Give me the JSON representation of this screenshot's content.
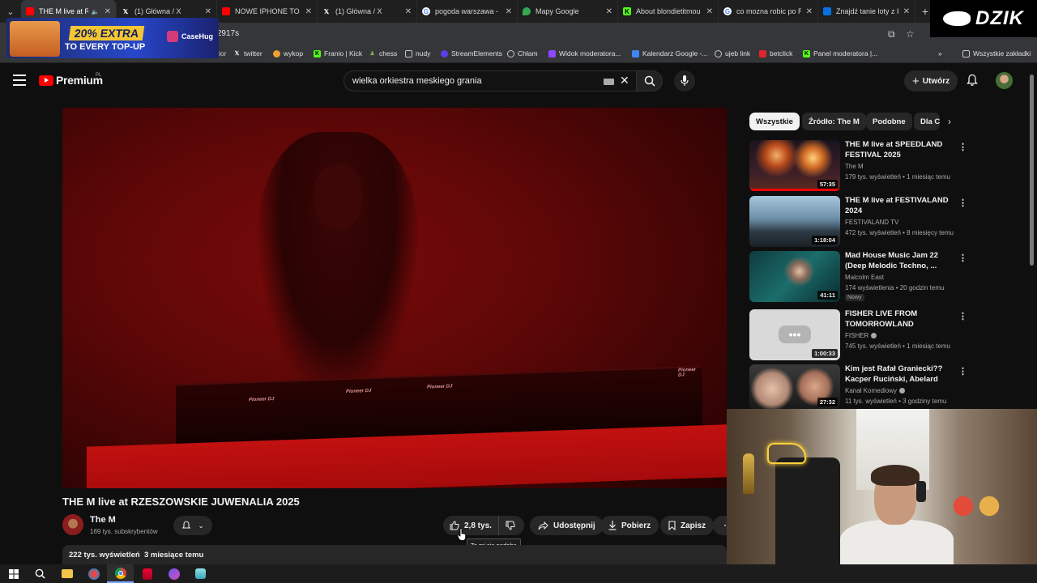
{
  "browser": {
    "tabs": [
      {
        "title": "THE M live at RZE",
        "favicon": "youtube-icon",
        "color": "#ff0000",
        "active": true,
        "muted_audio": true
      },
      {
        "title": "(1) Główna / X",
        "favicon": "x-icon",
        "color": "#ffffff"
      },
      {
        "title": "NOWE IPHONE TO P",
        "favicon": "youtube-icon",
        "color": "#ff0000"
      },
      {
        "title": "(1) Główna / X",
        "favicon": "x-icon",
        "color": "#ffffff"
      },
      {
        "title": "pogoda warszawa - S",
        "favicon": "google-icon",
        "color": "#4285f4"
      },
      {
        "title": "Mapy Google",
        "favicon": "maps-icon",
        "color": "#34a853"
      },
      {
        "title": "About blondietitmou",
        "favicon": "kick-icon",
        "color": "#53fc18"
      },
      {
        "title": "co mozna robic po R",
        "favicon": "google-icon",
        "color": "#4285f4"
      },
      {
        "title": "Znajdź tanie loty z K",
        "favicon": "flights-icon",
        "color": "#0770e3"
      }
    ],
    "url": "=2917s",
    "bookmarks": [
      {
        "label": "twitter",
        "icon": "x-icon",
        "color": "#ffffff"
      },
      {
        "label": "wykop",
        "icon": "wykop-icon",
        "color": "#f0a030"
      },
      {
        "label": "Franio | Kick",
        "icon": "kick-icon",
        "color": "#53fc18"
      },
      {
        "label": "chess",
        "icon": "chess-icon",
        "color": "#7fa650"
      },
      {
        "label": "nudy",
        "icon": "folder-icon",
        "color": "#c8c8c8"
      },
      {
        "label": "StreamElements",
        "icon": "streamelements-icon",
        "color": "#5a3fe6"
      },
      {
        "label": "Chłam",
        "icon": "globe-icon",
        "color": "#c8c8c8"
      },
      {
        "label": "Widok moderatora...",
        "icon": "twitch-icon",
        "color": "#9146ff"
      },
      {
        "label": "Kalendarz Google -...",
        "icon": "calendar-icon",
        "color": "#4285f4"
      },
      {
        "label": "ujeb link",
        "icon": "globe-icon",
        "color": "#c8c8c8"
      },
      {
        "label": "betclick",
        "icon": "betclic-icon",
        "color": "#e3262c"
      },
      {
        "label": "Panel moderatora |...",
        "icon": "kick-icon",
        "color": "#53fc18"
      }
    ],
    "bookmarks_more_icon": "chevron-right-icon",
    "all_bookmarks_label": "Wszystkie zakładki"
  },
  "overlay": {
    "ad_line1": "20% EXTRA",
    "ad_line2": "TO EVERY TOP-UP",
    "ad_brand": "CaseHug",
    "stream_logo": "DZIK"
  },
  "youtube": {
    "logo_text": "Premium",
    "country": "PL",
    "search_value": "wielka orkiestra meskiego grania",
    "create_label": "Utwórz",
    "video": {
      "title": "THE M live at RZESZOWSKIE JUWENALIA 2025",
      "channel": "The M",
      "subscribers": "169 tys. subskrybentów",
      "likes": "2,8 tys.",
      "like_tooltip": "To mi się podoba",
      "share_label": "Udostępnij",
      "download_label": "Pobierz",
      "save_label": "Zapisz",
      "views": "222 tys. wyświetleń",
      "date": "3 miesiące temu",
      "brand_marks": [
        "Pioneer DJ",
        "Pioneer DJ",
        "Pioneer DJ",
        "Pioneer DJ"
      ]
    },
    "chips": [
      "Wszystkie",
      "Źródło: The M",
      "Podobne",
      "Dla C"
    ],
    "recommendations": [
      {
        "title": "THE M live at SPEEDLAND FESTIVAL 2025",
        "channel": "The M",
        "verified": false,
        "meta": "179 tys. wyświetleń • 1 miesiąc temu",
        "duration": "57:35",
        "watched_fraction": 1.0,
        "badge": ""
      },
      {
        "title": "THE M live at FESTIVALAND 2024",
        "channel": "FESTIVALAND TV",
        "verified": false,
        "meta": "472 tys. wyświetleń • 8 miesięcy temu",
        "duration": "1:18:04",
        "watched_fraction": 0.0,
        "badge": ""
      },
      {
        "title": "Mad House Music Jam 22 (Deep Melodic Techno, ...",
        "channel": "Malcolm East",
        "verified": false,
        "meta": "174 wyświetlenia • 20 godzin temu",
        "duration": "41:11",
        "watched_fraction": 0.0,
        "badge": "Nowy"
      },
      {
        "title": "FISHER LIVE FROM TOMORROWLAND MAINSTAG...",
        "channel": "FISHER",
        "verified": true,
        "meta": "745 tys. wyświetleń • 1 miesiąc temu",
        "duration": "1:00:33",
        "watched_fraction": 0.0,
        "badge": ""
      },
      {
        "title": "Kim jest Rafał Graniecki?? Kacper Ruciński, Abelard Giza,...",
        "channel": "Kanał Komediowy",
        "verified": true,
        "meta": "11 tys. wyświetleń • 3 godziny temu",
        "duration": "27:32",
        "watched_fraction": 0.0,
        "badge": ""
      }
    ]
  },
  "taskbar": {
    "items": [
      "windows-start-icon",
      "search-icon",
      "file-explorer-icon",
      "app-icon",
      "chrome-icon",
      "app-icon",
      "app-icon",
      "app-icon"
    ]
  }
}
